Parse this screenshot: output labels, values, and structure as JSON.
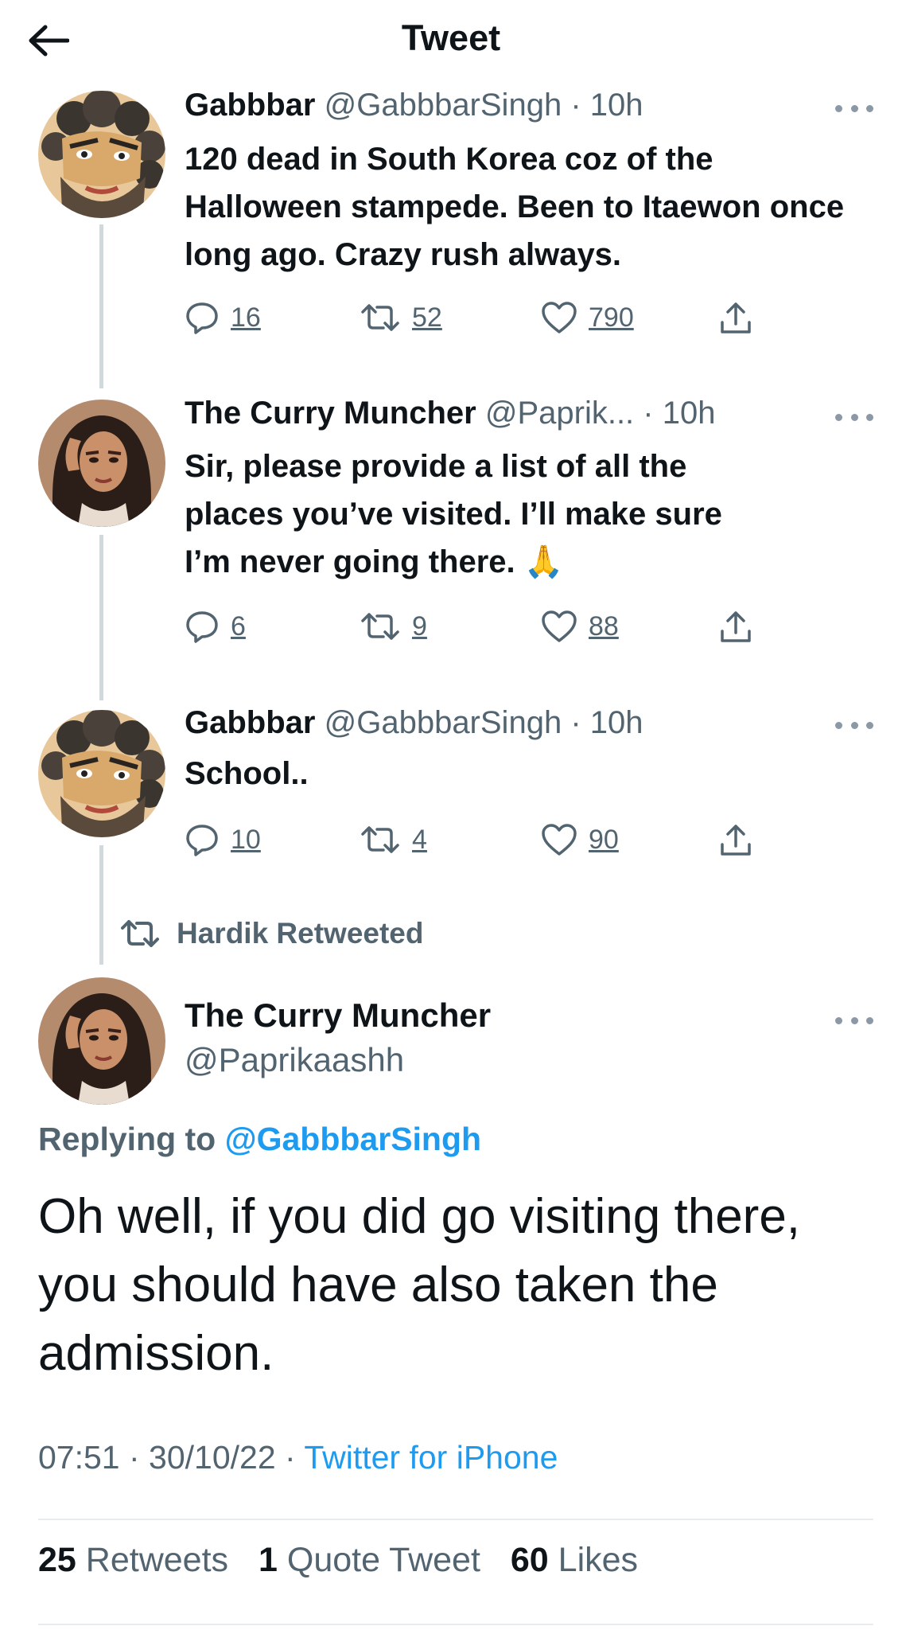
{
  "header": {
    "title": "Tweet"
  },
  "thread": [
    {
      "name": "Gabbbar",
      "handle": "@GabbbarSingh",
      "time": "· 10h",
      "text": "120 dead in South Korea coz of the Halloween stampede. Been to Itaewon once long ago. Crazy rush always.",
      "replies": "16",
      "retweets": "52",
      "likes": "790"
    },
    {
      "name": "The Curry Muncher",
      "handle": "@Paprik...",
      "time": "· 10h",
      "text": "Sir, please provide a list of all the places you’ve visited. I’ll make sure I’m never going there. 🙏",
      "replies": "6",
      "retweets": "9",
      "likes": "88"
    },
    {
      "name": "Gabbbar",
      "handle": "@GabbbarSingh",
      "time": "· 10h",
      "text": "School..",
      "replies": "10",
      "retweets": "4",
      "likes": "90"
    }
  ],
  "retweet_banner": "Hardik Retweeted",
  "main_tweet": {
    "name": "The Curry Muncher",
    "handle": "@Paprikaashh",
    "replying_prefix": "Replying to",
    "replying_handle": "@GabbbarSingh",
    "text": "Oh well, if you did go visiting there, you should have also taken the admission.",
    "time": "07:51 · 30/10/22 ·",
    "source": "Twitter for iPhone",
    "stats": {
      "retweets_count": "25",
      "retweets_label": "Retweets",
      "quotes_count": "1",
      "quotes_label": "Quote Tweet",
      "likes_count": "60",
      "likes_label": "Likes"
    }
  },
  "colors": {
    "accent": "#1d9bf0",
    "secondary_text": "#536471",
    "primary_text": "#0f1419"
  }
}
